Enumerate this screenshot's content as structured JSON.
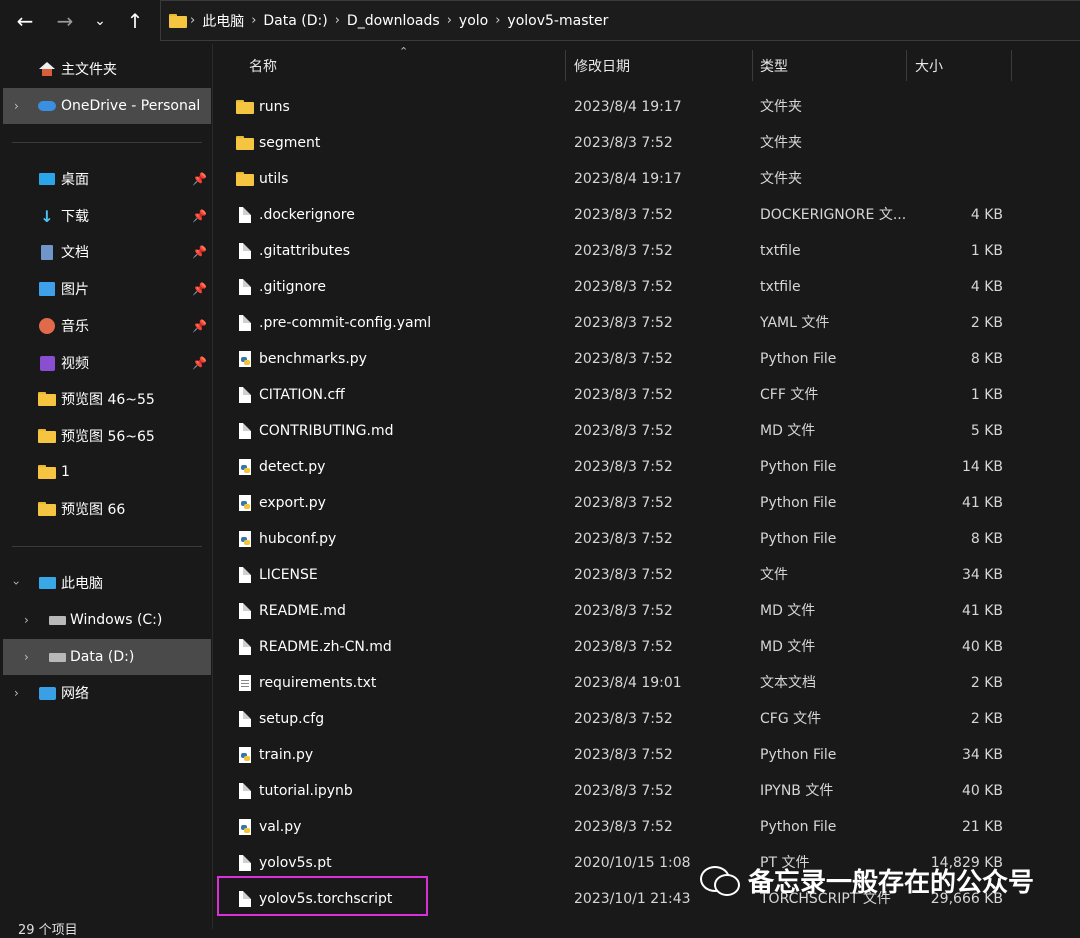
{
  "nav": {
    "back_icon": "arrow-left-icon",
    "forward_icon": "arrow-right-icon",
    "recent_icon": "chevron-down-icon",
    "up_icon": "arrow-up-icon"
  },
  "address_bar": {
    "crumbs": [
      "此电脑",
      "Data (D:)",
      "D_downloads",
      "yolo",
      "yolov5-master"
    ]
  },
  "sidebar": {
    "items": [
      {
        "label": "主文件夹",
        "icon": "home-icon"
      },
      {
        "label": "OneDrive - Personal",
        "icon": "onedrive-cloud-icon"
      },
      {
        "label": "桌面",
        "icon": "desktop-icon"
      },
      {
        "label": "下载",
        "icon": "download-icon"
      },
      {
        "label": "文档",
        "icon": "documents-icon"
      },
      {
        "label": "图片",
        "icon": "pictures-icon"
      },
      {
        "label": "音乐",
        "icon": "music-icon"
      },
      {
        "label": "视频",
        "icon": "videos-icon"
      },
      {
        "label": "预览图 46~55",
        "icon": "folder-icon"
      },
      {
        "label": "预览图 56~65",
        "icon": "folder-icon"
      },
      {
        "label": "1",
        "icon": "folder-icon"
      },
      {
        "label": "预览图 66",
        "icon": "folder-icon"
      },
      {
        "label": "此电脑",
        "icon": "this-pc-icon"
      },
      {
        "label": "Windows (C:)",
        "icon": "drive-icon"
      },
      {
        "label": "Data (D:)",
        "icon": "drive-icon"
      },
      {
        "label": "网络",
        "icon": "network-icon"
      }
    ]
  },
  "status": {
    "item_count": "29 个项目"
  },
  "columns": {
    "name": "名称",
    "date": "修改日期",
    "type": "类型",
    "size": "大小"
  },
  "files": [
    {
      "name": "runs",
      "date": "2023/8/4 19:17",
      "type": "文件夹",
      "size": "",
      "icon": "folder"
    },
    {
      "name": "segment",
      "date": "2023/8/3 7:52",
      "type": "文件夹",
      "size": "",
      "icon": "folder"
    },
    {
      "name": "utils",
      "date": "2023/8/4 19:17",
      "type": "文件夹",
      "size": "",
      "icon": "folder"
    },
    {
      "name": ".dockerignore",
      "date": "2023/8/3 7:52",
      "type": "DOCKERIGNORE 文...",
      "size": "4 KB",
      "icon": "file"
    },
    {
      "name": ".gitattributes",
      "date": "2023/8/3 7:52",
      "type": "txtfile",
      "size": "1 KB",
      "icon": "file"
    },
    {
      "name": ".gitignore",
      "date": "2023/8/3 7:52",
      "type": "txtfile",
      "size": "4 KB",
      "icon": "file"
    },
    {
      "name": ".pre-commit-config.yaml",
      "date": "2023/8/3 7:52",
      "type": "YAML 文件",
      "size": "2 KB",
      "icon": "file"
    },
    {
      "name": "benchmarks.py",
      "date": "2023/8/3 7:52",
      "type": "Python File",
      "size": "8 KB",
      "icon": "python"
    },
    {
      "name": "CITATION.cff",
      "date": "2023/8/3 7:52",
      "type": "CFF 文件",
      "size": "1 KB",
      "icon": "file"
    },
    {
      "name": "CONTRIBUTING.md",
      "date": "2023/8/3 7:52",
      "type": "MD 文件",
      "size": "5 KB",
      "icon": "file"
    },
    {
      "name": "detect.py",
      "date": "2023/8/3 7:52",
      "type": "Python File",
      "size": "14 KB",
      "icon": "python"
    },
    {
      "name": "export.py",
      "date": "2023/8/3 7:52",
      "type": "Python File",
      "size": "41 KB",
      "icon": "python"
    },
    {
      "name": "hubconf.py",
      "date": "2023/8/3 7:52",
      "type": "Python File",
      "size": "8 KB",
      "icon": "python"
    },
    {
      "name": "LICENSE",
      "date": "2023/8/3 7:52",
      "type": "文件",
      "size": "34 KB",
      "icon": "file"
    },
    {
      "name": "README.md",
      "date": "2023/8/3 7:52",
      "type": "MD 文件",
      "size": "41 KB",
      "icon": "file"
    },
    {
      "name": "README.zh-CN.md",
      "date": "2023/8/3 7:52",
      "type": "MD 文件",
      "size": "40 KB",
      "icon": "file"
    },
    {
      "name": "requirements.txt",
      "date": "2023/8/4 19:01",
      "type": "文本文档",
      "size": "2 KB",
      "icon": "text"
    },
    {
      "name": "setup.cfg",
      "date": "2023/8/3 7:52",
      "type": "CFG 文件",
      "size": "2 KB",
      "icon": "file"
    },
    {
      "name": "train.py",
      "date": "2023/8/3 7:52",
      "type": "Python File",
      "size": "34 KB",
      "icon": "python"
    },
    {
      "name": "tutorial.ipynb",
      "date": "2023/8/3 7:52",
      "type": "IPYNB 文件",
      "size": "40 KB",
      "icon": "file"
    },
    {
      "name": "val.py",
      "date": "2023/8/3 7:52",
      "type": "Python File",
      "size": "21 KB",
      "icon": "python"
    },
    {
      "name": "yolov5s.pt",
      "date": "2020/10/15 1:08",
      "type": "PT 文件",
      "size": "14,829 KB",
      "icon": "file"
    },
    {
      "name": "yolov5s.torchscript",
      "date": "2023/10/1 21:43",
      "type": "TORCHSCRIPT 文件",
      "size": "29,666 KB",
      "icon": "file"
    }
  ],
  "watermark": {
    "text": "备忘录一般存在的公众号",
    "icon": "wechat-icon"
  },
  "colors": {
    "background": "#191919",
    "selected": "#4a4a4a",
    "highlight_box": "#d732d7",
    "folder": "#f5c542"
  }
}
